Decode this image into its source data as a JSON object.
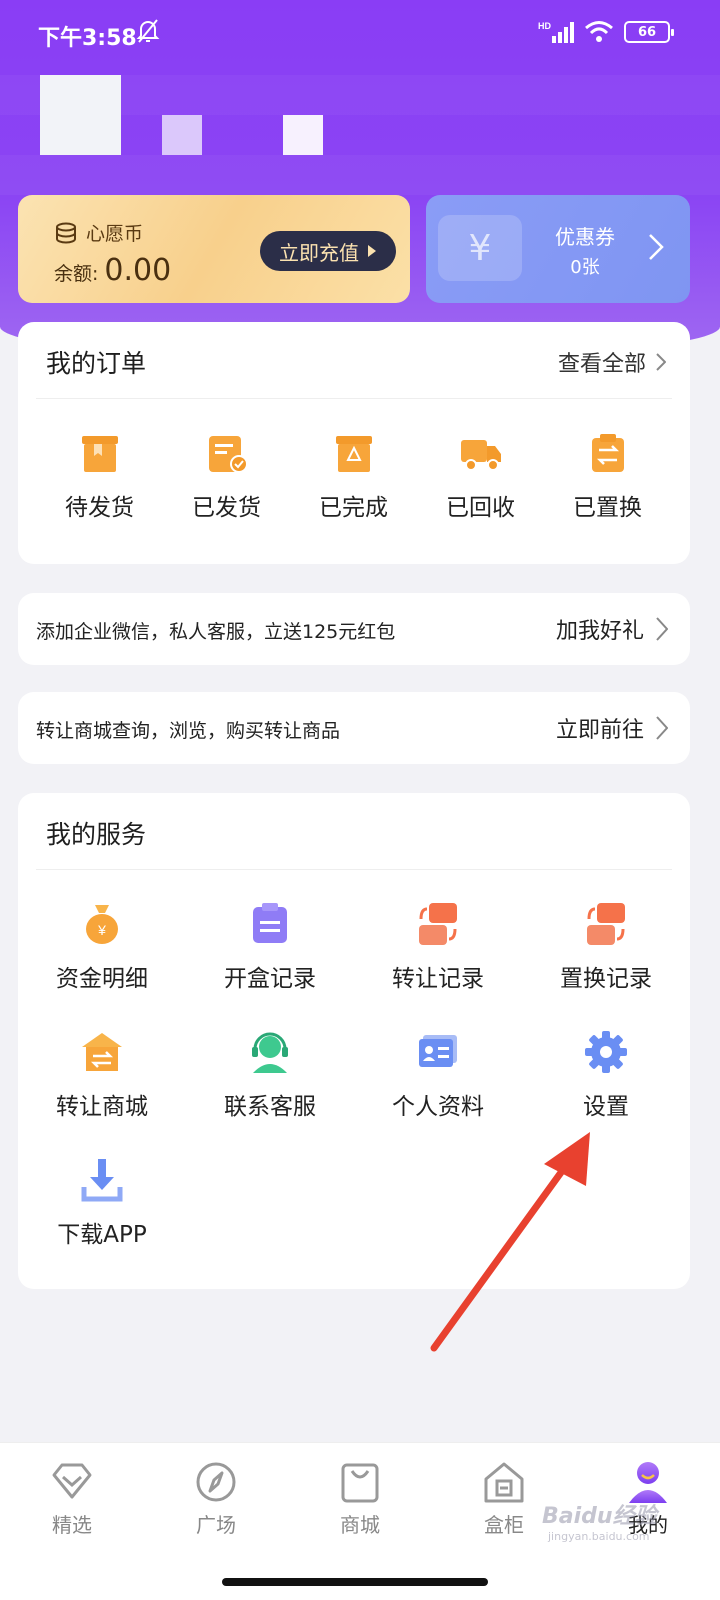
{
  "status_bar": {
    "time": "下午3:58",
    "battery": "66",
    "signal_label": "HD"
  },
  "wallet": {
    "coin_title": "心愿币",
    "balance_label": "余额:",
    "balance_value": "0.00",
    "recharge_label": "立即充值",
    "coupon_title": "优惠券",
    "coupon_count": "0张"
  },
  "orders": {
    "title": "我的订单",
    "view_all": "查看全部",
    "items": [
      {
        "label": "待发货",
        "icon": "box-icon"
      },
      {
        "label": "已发货",
        "icon": "shipped-doc-icon"
      },
      {
        "label": "已完成",
        "icon": "recycle-box-icon"
      },
      {
        "label": "已回收",
        "icon": "truck-icon"
      },
      {
        "label": "已置换",
        "icon": "exchange-clipboard-icon"
      }
    ]
  },
  "banners": [
    {
      "text": "添加企业微信，私人客服，立送125元红包",
      "action": "加我好礼"
    },
    {
      "text": "转让商城查询，浏览，购买转让商品",
      "action": "立即前往"
    }
  ],
  "services": {
    "title": "我的服务",
    "items": [
      {
        "label": "资金明细",
        "icon": "money-bag-icon"
      },
      {
        "label": "开盒记录",
        "icon": "clipboard-list-icon"
      },
      {
        "label": "转让记录",
        "icon": "transfer-icon"
      },
      {
        "label": "置换记录",
        "icon": "exchange-icon"
      },
      {
        "label": "转让商城",
        "icon": "store-icon"
      },
      {
        "label": "联系客服",
        "icon": "headset-icon"
      },
      {
        "label": "个人资料",
        "icon": "id-card-icon"
      },
      {
        "label": "设置",
        "icon": "gear-icon"
      },
      {
        "label": "下载APP",
        "icon": "download-icon"
      }
    ]
  },
  "tabbar": {
    "items": [
      {
        "label": "精选",
        "icon": "diamond-icon"
      },
      {
        "label": "广场",
        "icon": "compass-icon"
      },
      {
        "label": "商城",
        "icon": "shopping-bag-icon"
      },
      {
        "label": "盒柜",
        "icon": "cabinet-icon"
      },
      {
        "label": "我的",
        "icon": "profile-icon"
      }
    ],
    "active": "我的"
  },
  "watermark": {
    "text": "Baidu经验",
    "sub": "jingyan.baidu.com"
  },
  "colors": {
    "header_purple": "#8a3df5",
    "order_icon_orange": "#f7a53a",
    "service_icon_purple": "#8f7cf6",
    "service_icon_orange": "#f5724a",
    "service_icon_blue": "#6a8ef3",
    "service_icon_green": "#3ec98f",
    "annotation_red": "#e8412f"
  }
}
